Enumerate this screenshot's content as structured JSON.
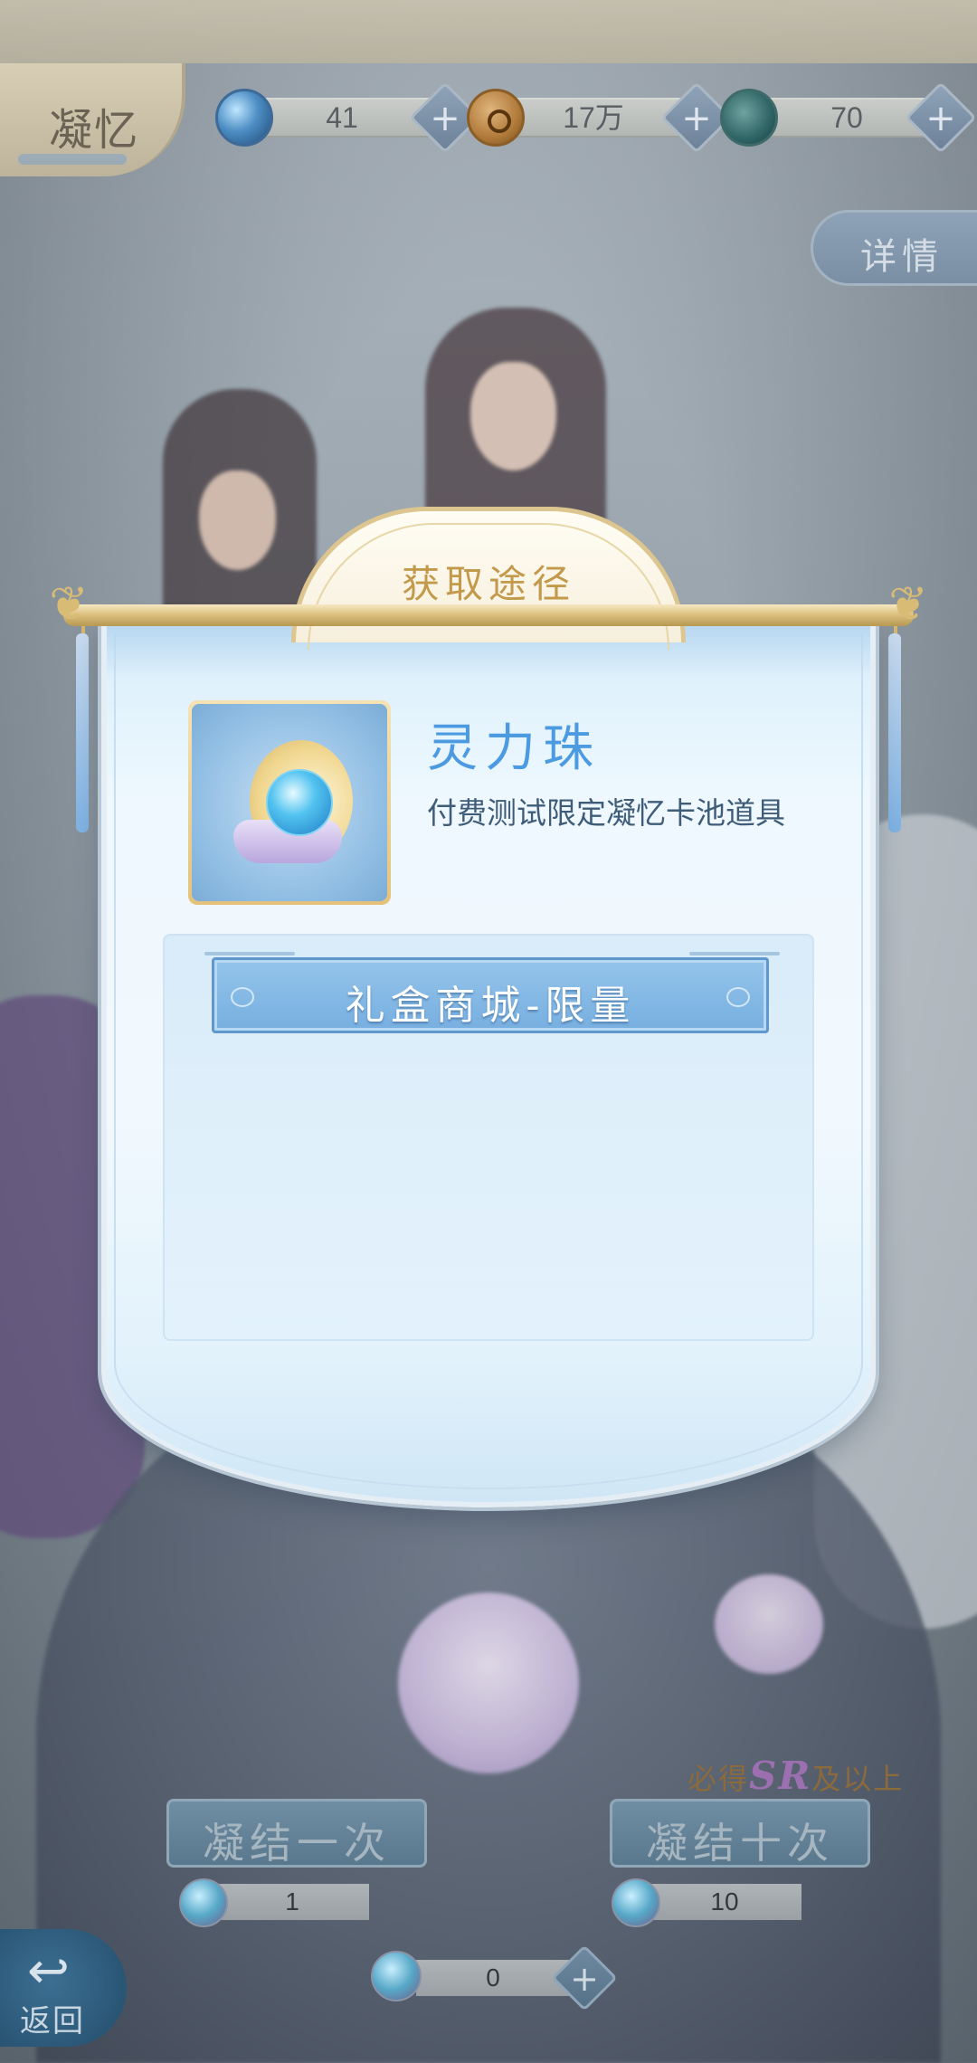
{
  "header": {
    "title": "凝忆",
    "resources": [
      {
        "icon": "spirit-orb-icon",
        "value": "41"
      },
      {
        "icon": "coin-icon",
        "value": "17万"
      },
      {
        "icon": "serpent-icon",
        "value": "70"
      }
    ],
    "details_label": "详情"
  },
  "modal": {
    "title": "获取途径",
    "item": {
      "icon": "spirit-pearl-item-icon",
      "name": "灵力珠",
      "description": "付费测试限定凝忆卡池道具"
    },
    "sources": [
      {
        "label": "礼盒商城-限量"
      }
    ]
  },
  "bottom": {
    "guarantee_text_pre": "必得",
    "guarantee_text_rank": "SR",
    "guarantee_text_post": "及以上",
    "draw_once_label": "凝结一次",
    "draw_ten_label": "凝结十次",
    "draw_once_cost": "1",
    "draw_ten_cost": "10",
    "owned_count": "0",
    "back_label": "返回"
  },
  "colors": {
    "accent_blue": "#4c9be0",
    "gold": "#c39a4c",
    "description": "#3f5d79"
  }
}
